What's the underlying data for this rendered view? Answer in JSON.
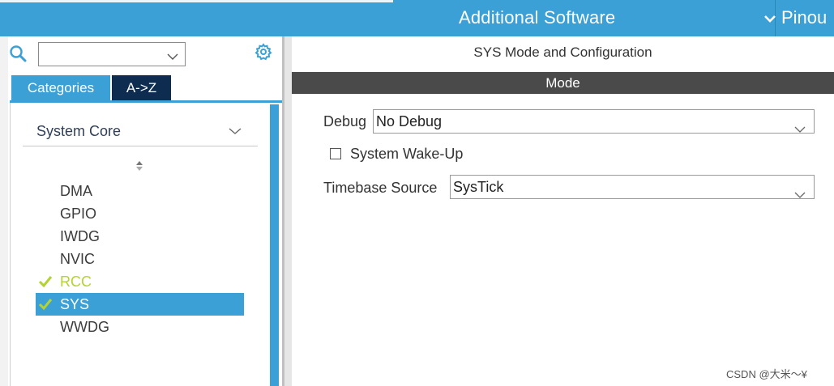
{
  "header": {
    "active_tab": "Additional Software",
    "next_tab": "Pinou"
  },
  "left_panel": {
    "search": {
      "value": ""
    },
    "tabs": {
      "categories": "Categories",
      "az": "A->Z"
    },
    "category": "System Core",
    "items": [
      {
        "label": "DMA",
        "checked": false,
        "selected": false
      },
      {
        "label": "GPIO",
        "checked": false,
        "selected": false
      },
      {
        "label": "IWDG",
        "checked": false,
        "selected": false
      },
      {
        "label": "NVIC",
        "checked": false,
        "selected": false
      },
      {
        "label": "RCC",
        "checked": true,
        "selected": false
      },
      {
        "label": "SYS",
        "checked": true,
        "selected": true
      },
      {
        "label": "WWDG",
        "checked": false,
        "selected": false
      }
    ]
  },
  "right_panel": {
    "title": "SYS Mode and Configuration",
    "section": "Mode",
    "debug": {
      "label": "Debug",
      "value": "No Debug"
    },
    "wakeup": {
      "label": "System Wake-Up",
      "checked": false
    },
    "timebase": {
      "label": "Timebase Source",
      "value": "SysTick"
    }
  },
  "watermark": "CSDN @大米～¥",
  "colors": {
    "accent": "#3aa0d6",
    "dark_tab": "#0d2c4f",
    "mode_bar": "#4a4a4a",
    "checked": "#b3d332"
  }
}
